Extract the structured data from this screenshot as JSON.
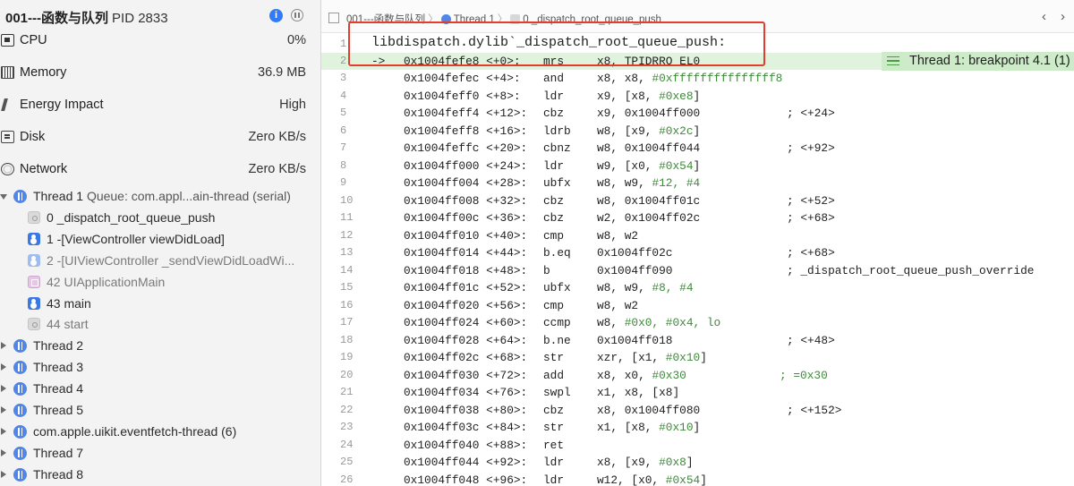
{
  "sidebar": {
    "process": {
      "name": "001---函数与队列",
      "pid": "PID 2833"
    },
    "gauges": [
      {
        "label": "CPU",
        "value": "0%",
        "icon": "cpu-icon"
      },
      {
        "label": "Memory",
        "value": "36.9 MB",
        "icon": "memory-icon"
      },
      {
        "label": "Energy Impact",
        "value": "High",
        "icon": "energy-icon"
      },
      {
        "label": "Disk",
        "value": "Zero KB/s",
        "icon": "disk-icon"
      },
      {
        "label": "Network",
        "value": "Zero KB/s",
        "icon": "network-icon"
      }
    ],
    "thread1": {
      "label": "Thread 1",
      "queue": "Queue: com.appl...ain-thread (serial)",
      "frames": [
        {
          "label": "0 _dispatch_root_queue_push",
          "icon": "gray"
        },
        {
          "label": "1 -[ViewController viewDidLoad]",
          "icon": "blue"
        },
        {
          "label": "2 -[UIViewController _sendViewDidLoadWi...",
          "icon": "lightblue"
        },
        {
          "label": "42 UIApplicationMain",
          "icon": "pink"
        },
        {
          "label": "43 main",
          "icon": "blue"
        },
        {
          "label": "44 start",
          "icon": "gray"
        }
      ]
    },
    "threads": [
      "Thread 2",
      "Thread 3",
      "Thread 4",
      "Thread 5",
      "com.apple.uikit.eventfetch-thread (6)",
      "Thread 7",
      "Thread 8"
    ]
  },
  "jumpbar": {
    "project": "001---函数与队列",
    "thread": "Thread 1",
    "frame": "0 _dispatch_root_queue_push"
  },
  "editor": {
    "title_line": {
      "num": "1",
      "text": "libdispatch.dylib`_dispatch_root_queue_push:"
    },
    "breakpoint_badge": "Thread 1: breakpoint 4.1 (1)",
    "lines": [
      {
        "num": "2",
        "arrow": "->",
        "addr": "0x1004fefe8 <+0>:",
        "mn": "mrs",
        "op": "x8, ",
        "imm": "",
        "op2": "TPIDRRO_EL0",
        "cmt": ""
      },
      {
        "num": "3",
        "arrow": "",
        "addr": "0x1004fefec <+4>:",
        "mn": "and",
        "op": "x8, x8, ",
        "imm": "#0xfffffffffffffff8",
        "op2": "",
        "cmt": ""
      },
      {
        "num": "4",
        "arrow": "",
        "addr": "0x1004feff0 <+8>:",
        "mn": "ldr",
        "op": "x9, [x8, ",
        "imm": "#0xe8",
        "op2": "]",
        "cmt": ""
      },
      {
        "num": "5",
        "arrow": "",
        "addr": "0x1004feff4 <+12>:",
        "mn": "cbz",
        "op": "x9, 0x1004ff000",
        "imm": "",
        "op2": "",
        "cmt": "; <+24>"
      },
      {
        "num": "6",
        "arrow": "",
        "addr": "0x1004feff8 <+16>:",
        "mn": "ldrb",
        "op": "w8, [x9, ",
        "imm": "#0x2c",
        "op2": "]",
        "cmt": ""
      },
      {
        "num": "7",
        "arrow": "",
        "addr": "0x1004feffc <+20>:",
        "mn": "cbnz",
        "op": "w8, 0x1004ff044",
        "imm": "",
        "op2": "",
        "cmt": "; <+92>"
      },
      {
        "num": "8",
        "arrow": "",
        "addr": "0x1004ff000 <+24>:",
        "mn": "ldr",
        "op": "w9, [x0, ",
        "imm": "#0x54",
        "op2": "]",
        "cmt": ""
      },
      {
        "num": "9",
        "arrow": "",
        "addr": "0x1004ff004 <+28>:",
        "mn": "ubfx",
        "op": "w8, w9, ",
        "imm": "#12, #4",
        "op2": "",
        "cmt": ""
      },
      {
        "num": "10",
        "arrow": "",
        "addr": "0x1004ff008 <+32>:",
        "mn": "cbz",
        "op": "w8, 0x1004ff01c",
        "imm": "",
        "op2": "",
        "cmt": "; <+52>"
      },
      {
        "num": "11",
        "arrow": "",
        "addr": "0x1004ff00c <+36>:",
        "mn": "cbz",
        "op": "w2, 0x1004ff02c",
        "imm": "",
        "op2": "",
        "cmt": "; <+68>"
      },
      {
        "num": "12",
        "arrow": "",
        "addr": "0x1004ff010 <+40>:",
        "mn": "cmp",
        "op": "w8, w2",
        "imm": "",
        "op2": "",
        "cmt": ""
      },
      {
        "num": "13",
        "arrow": "",
        "addr": "0x1004ff014 <+44>:",
        "mn": "b.eq",
        "op": "0x1004ff02c",
        "imm": "",
        "op2": "",
        "cmt": "; <+68>"
      },
      {
        "num": "14",
        "arrow": "",
        "addr": "0x1004ff018 <+48>:",
        "mn": "b",
        "op": "0x1004ff090",
        "imm": "",
        "op2": "",
        "cmt": "; _dispatch_root_queue_push_override"
      },
      {
        "num": "15",
        "arrow": "",
        "addr": "0x1004ff01c <+52>:",
        "mn": "ubfx",
        "op": "w8, w9, ",
        "imm": "#8, #4",
        "op2": "",
        "cmt": ""
      },
      {
        "num": "16",
        "arrow": "",
        "addr": "0x1004ff020 <+56>:",
        "mn": "cmp",
        "op": "w8, w2",
        "imm": "",
        "op2": "",
        "cmt": ""
      },
      {
        "num": "17",
        "arrow": "",
        "addr": "0x1004ff024 <+60>:",
        "mn": "ccmp",
        "op": "w8, ",
        "imm": "#0x0, #0x4, lo",
        "op2": "",
        "cmt": ""
      },
      {
        "num": "18",
        "arrow": "",
        "addr": "0x1004ff028 <+64>:",
        "mn": "b.ne",
        "op": "0x1004ff018",
        "imm": "",
        "op2": "",
        "cmt": "; <+48>"
      },
      {
        "num": "19",
        "arrow": "",
        "addr": "0x1004ff02c <+68>:",
        "mn": "str",
        "op": "xzr, [x1, ",
        "imm": "#0x10",
        "op2": "]",
        "cmt": ""
      },
      {
        "num": "20",
        "arrow": "",
        "addr": "0x1004ff030 <+72>:",
        "mn": "add",
        "op": "x8, x0, ",
        "imm": "#0x30",
        "op2": "",
        "cmt": "",
        "cmt_green": "; =0x30"
      },
      {
        "num": "21",
        "arrow": "",
        "addr": "0x1004ff034 <+76>:",
        "mn": "swpl",
        "op": "x1, x8, [x8]",
        "imm": "",
        "op2": "",
        "cmt": ""
      },
      {
        "num": "22",
        "arrow": "",
        "addr": "0x1004ff038 <+80>:",
        "mn": "cbz",
        "op": "x8, 0x1004ff080",
        "imm": "",
        "op2": "",
        "cmt": "; <+152>"
      },
      {
        "num": "23",
        "arrow": "",
        "addr": "0x1004ff03c <+84>:",
        "mn": "str",
        "op": "x1, [x8, ",
        "imm": "#0x10",
        "op2": "]",
        "cmt": ""
      },
      {
        "num": "24",
        "arrow": "",
        "addr": "0x1004ff040 <+88>:",
        "mn": "ret",
        "op": "",
        "imm": "",
        "op2": "",
        "cmt": ""
      },
      {
        "num": "25",
        "arrow": "",
        "addr": "0x1004ff044 <+92>:",
        "mn": "ldr",
        "op": "x8, [x9, ",
        "imm": "#0x8",
        "op2": "]",
        "cmt": ""
      },
      {
        "num": "26",
        "arrow": "",
        "addr": "0x1004ff048 <+96>:",
        "mn": "ldr",
        "op": "w12, [x0, ",
        "imm": "#0x54",
        "op2": "]",
        "cmt": ""
      }
    ]
  },
  "colors": {
    "accent": "#4f86e8",
    "highlight": "#dff3dd",
    "badge": "#cdebc9",
    "annotation": "#e53c2f",
    "immediate": "#3e8a3a"
  }
}
